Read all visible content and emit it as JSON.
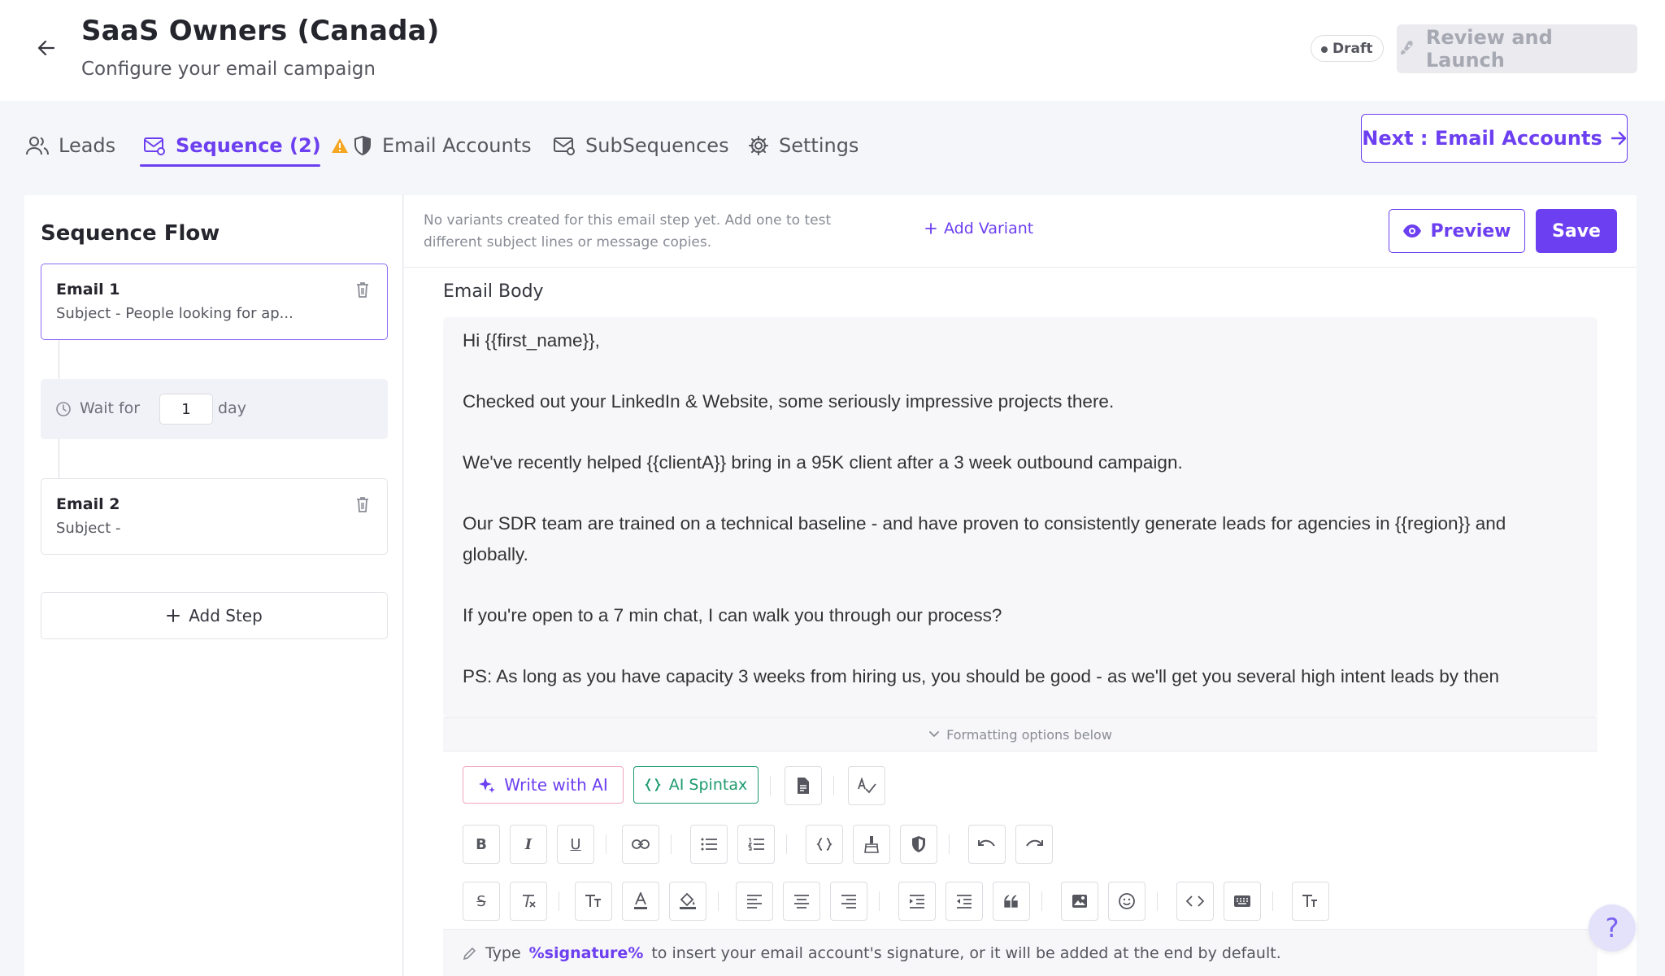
{
  "header": {
    "title": "SaaS Owners (Canada)",
    "subtitle": "Configure your email campaign",
    "status_badge": "Draft",
    "review_button": "Review and Launch"
  },
  "tabs": [
    {
      "label": "Leads",
      "icon": "users-icon"
    },
    {
      "label": "Sequence (2)",
      "icon": "mail-cog-icon",
      "active": true,
      "warning": true
    },
    {
      "label": "Email Accounts",
      "icon": "shield-icon"
    },
    {
      "label": "SubSequences",
      "icon": "mail-cog-icon"
    },
    {
      "label": "Settings",
      "icon": "gear-icon"
    }
  ],
  "next_button": "Next : Email Accounts",
  "sequence": {
    "title": "Sequence Flow",
    "steps": [
      {
        "name": "Email 1",
        "subject": "Subject - People looking for ap..."
      },
      {
        "name": "Email 2",
        "subject": "Subject -"
      }
    ],
    "wait": {
      "label": "Wait for",
      "value": "1",
      "unit": "day"
    },
    "add_step": "Add Step"
  },
  "editor": {
    "variant_note": "No variants created for this email step yet. Add one to test different subject lines or message copies.",
    "add_variant": "Add Variant",
    "preview_button": "Preview",
    "save_button": "Save",
    "body_label": "Email Body",
    "body_lines": [
      "Hi {{first_name}},",
      "",
      "Checked out your LinkedIn & Website, some seriously impressive projects there.",
      "",
      "We've recently helped {{clientA}} bring in a 95K client after a 3 week outbound campaign.",
      "",
      "Our SDR team are trained on a technical baseline - and have proven to consistently generate leads for agencies in {{region}} and",
      "globally.",
      "",
      "If you're open to a 7 min chat, I can walk you through our process?",
      "",
      "PS: As long as you have capacity 3 weeks from hiring us, you should be good - as we'll get you several high intent leads by then"
    ],
    "formatting_toggle": "Formatting options below",
    "write_ai": "Write with AI",
    "ai_spintax": "AI Spintax",
    "signature_hint": {
      "prefix": "Type",
      "token": "%signature%",
      "suffix": "to insert your email account's signature, or it will be added at the end by default."
    }
  },
  "colors": {
    "accent": "#6c3ff0",
    "warning": "#f5a623",
    "spintax_green": "#1e9b6e",
    "ai_border": "#f0a6bd"
  }
}
